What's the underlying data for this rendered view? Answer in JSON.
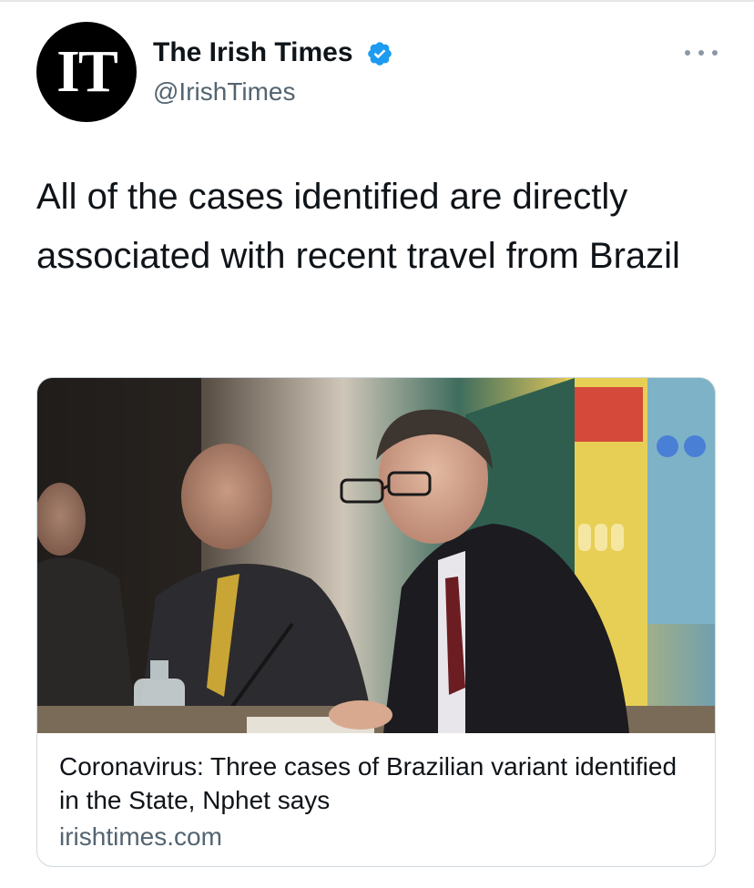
{
  "account": {
    "avatar_text": "IT",
    "display_name": "The Irish Times",
    "handle": "@IrishTimes",
    "verified": true
  },
  "tweet": {
    "text": "All of the cases identified are directly associated with recent travel from Brazil"
  },
  "card": {
    "image_description_icon": "press-photo",
    "title": "Coronavirus: Three cases of Brazilian variant identified in the State, Nphet says",
    "domain": "irishtimes.com"
  },
  "colors": {
    "verified_blue": "#1d9bf0",
    "secondary_text": "#536471",
    "border": "#cfd9de"
  }
}
